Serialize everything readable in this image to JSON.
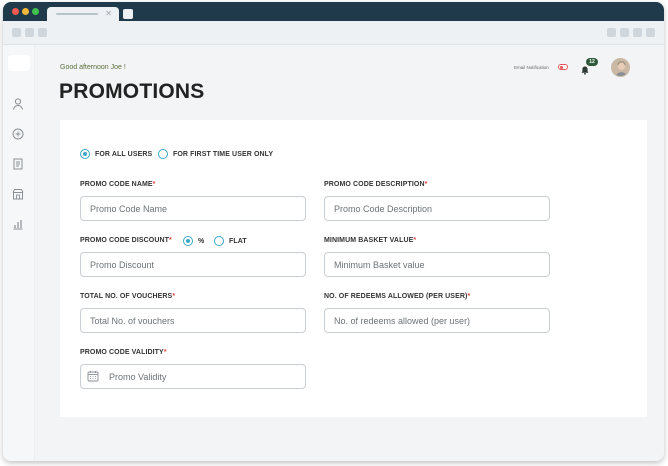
{
  "header": {
    "greeting": "Good afternoon Joe !",
    "title": "PROMOTIONS",
    "email_notification_label": "Email Notification",
    "notification_count": "12"
  },
  "colors": {
    "accent": "#3aa7c9",
    "required": "#e04444",
    "greeting": "#5a6e3a",
    "badge": "#2e5a3a",
    "window_titlebar": "#1f3a4a"
  },
  "sidebar": {
    "icons": [
      "user-icon",
      "add-circle-icon",
      "receipt-icon",
      "store-icon",
      "chart-icon"
    ]
  },
  "audience": {
    "options": [
      {
        "label": "FOR ALL USERS",
        "selected": true
      },
      {
        "label": "FOR FIRST TIME USER ONLY",
        "selected": false
      }
    ]
  },
  "form": {
    "promo_code_name": {
      "label": "PROMO CODE NAME",
      "required": "*",
      "placeholder": "Promo Code Name"
    },
    "promo_code_description": {
      "label": "PROMO CODE DESCRIPTION",
      "required": "*",
      "placeholder": "Promo Code Description"
    },
    "promo_code_discount": {
      "label": "PROMO CODE DISCOUNT",
      "required": "*",
      "placeholder": "Promo Discount",
      "types": [
        {
          "label": "%",
          "selected": true
        },
        {
          "label": "FLAT",
          "selected": false
        }
      ]
    },
    "minimum_basket_value": {
      "label": "MINIMUM BASKET VALUE",
      "required": "*",
      "placeholder": "Minimum Basket value"
    },
    "total_vouchers": {
      "label": "TOTAL NO. OF VOUCHERS",
      "required": "*",
      "placeholder": "Total No. of vouchers"
    },
    "redeems_allowed": {
      "label": "NO. OF REDEEMS ALLOWED (PER USER)",
      "required": "*",
      "placeholder": "No. of redeems allowed (per user)"
    },
    "promo_code_validity": {
      "label": "PROMO CODE VALIDITY",
      "required": "*",
      "placeholder": "Promo Validity"
    }
  }
}
